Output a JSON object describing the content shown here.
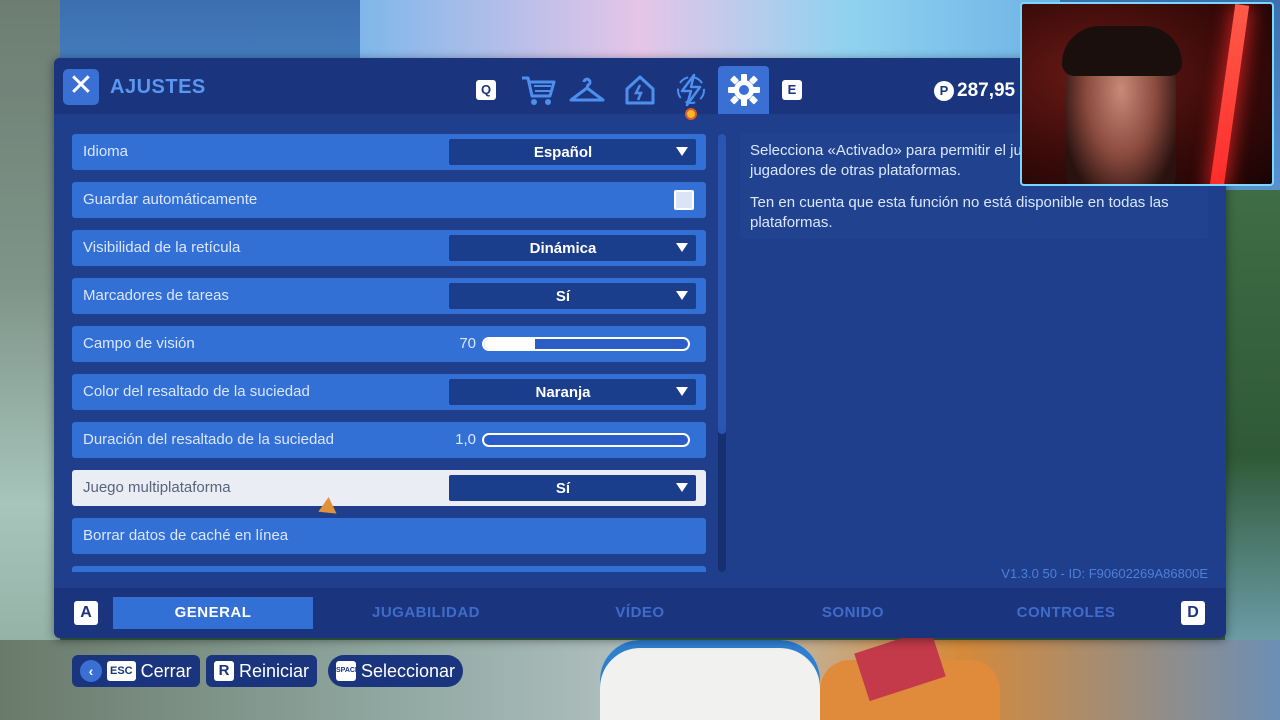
{
  "panel": {
    "title": "AJUSTES",
    "close_icon": "✕",
    "currency": {
      "symbol": "P",
      "value": "287,95"
    }
  },
  "top_tabs": {
    "left_key": "Q",
    "right_key": "E",
    "icons": [
      "cart-icon",
      "hanger-icon",
      "house-icon",
      "lightning-icon",
      "gear-icon"
    ],
    "active_icon": "gear-icon"
  },
  "settings": [
    {
      "label": "Idioma",
      "control": "dropdown",
      "value": "Español"
    },
    {
      "label": "Guardar automáticamente",
      "control": "checkbox",
      "checked": true
    },
    {
      "label": "Visibilidad de la retícula",
      "control": "dropdown",
      "value": "Dinámica"
    },
    {
      "label": "Marcadores de tareas",
      "control": "dropdown",
      "value": "Sí"
    },
    {
      "label": "Campo de visión",
      "control": "slider",
      "value": "70",
      "fill_fraction": 0.25
    },
    {
      "label": "Color del resaltado de la suciedad",
      "control": "dropdown",
      "value": "Naranja"
    },
    {
      "label": "Duración del resaltado de la suciedad",
      "control": "slider",
      "value": "1,0",
      "fill_fraction": 0.0
    },
    {
      "label": "Juego multiplataforma",
      "control": "dropdown",
      "value": "Sí",
      "active": true
    },
    {
      "label": "Borrar datos de caché en línea",
      "control": "none"
    }
  ],
  "description": {
    "line1": "Selecciona «Activado» para permitir el juego cruzado con jugadores de otras plataformas.",
    "line2": "Ten en cuenta que esta función no está disponible en todas las plataformas."
  },
  "version": "V1.3.0 50 - ID: F90602269A86800E",
  "bottom_tabs": {
    "left_key": "A",
    "right_key": "D",
    "tabs": [
      "GENERAL",
      "JUGABILIDAD",
      "VÍDEO",
      "SONIDO",
      "CONTROLES"
    ],
    "active": "GENERAL"
  },
  "hints": {
    "close": {
      "key": "ESC",
      "label": "Cerrar"
    },
    "reset": {
      "key": "R",
      "label": "Reiniciar"
    },
    "select": {
      "key": "SPACE",
      "label": "Seleccionar"
    }
  },
  "colors": {
    "panel_bg": "#1f3e8c",
    "row_bg": "#3370d6",
    "row_active_bg": "#eaedf4",
    "accent": "#4d8fee",
    "notification": "#f7b72a"
  }
}
